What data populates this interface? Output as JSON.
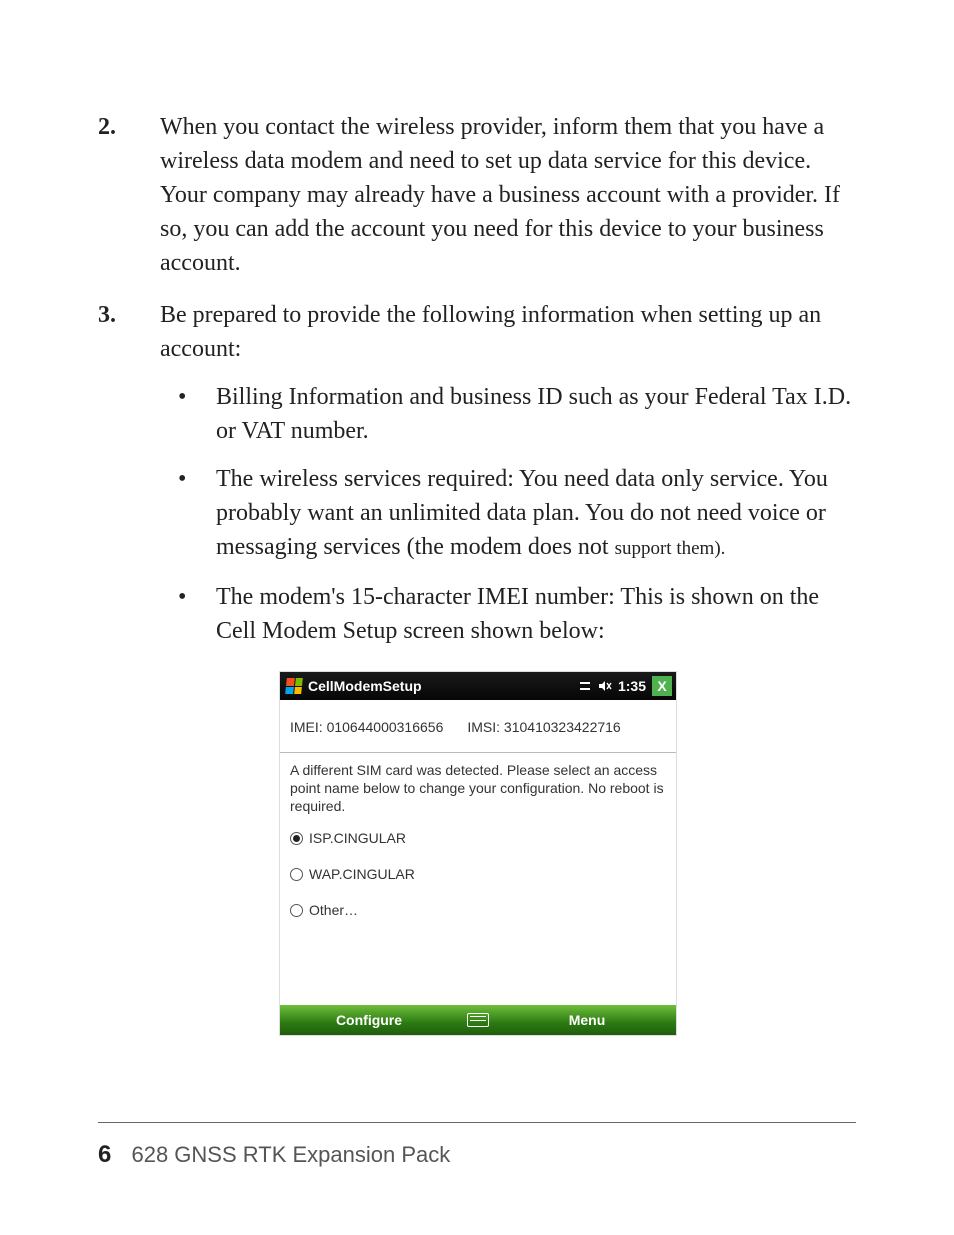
{
  "list": {
    "items": [
      {
        "num": "2.",
        "text": "When you contact the wireless provider, inform them that you have a wireless data modem and need to set up data service for this device. Your company may already have a business account with a provider. If so, you can add the account you need for this device to your business account."
      },
      {
        "num": "3.",
        "text": "Be prepared to provide the following information when setting up an account:",
        "bullets": [
          {
            "text": "Billing Information and business ID such as your Federal Tax I.D. or VAT number."
          },
          {
            "text_main": "The wireless services required: You need data only service. You probably want an unlimited data plan. You do not need voice or messaging services (the modem does not ",
            "text_small": "support them)."
          },
          {
            "text": "The modem's 15-character IMEI number: This is shown on the Cell Modem Setup screen shown below:"
          }
        ]
      }
    ]
  },
  "screenshot": {
    "title": "CellModemSetup",
    "clock": "1:35",
    "speaker_muted_label": "×",
    "close_label": "X",
    "imei_label": "IMEI: ",
    "imei_value": "010644000316656",
    "imsi_label": "IMSI: ",
    "imsi_value": "310410323422716",
    "detect_message": "A different SIM card was detected.  Please select an access point name below to change your configuration.  No reboot is required.",
    "radios": [
      {
        "label": "ISP.CINGULAR",
        "selected": true
      },
      {
        "label": "WAP.CINGULAR",
        "selected": false
      },
      {
        "label": "Other…",
        "selected": false
      }
    ],
    "soft_left": "Configure",
    "soft_right": "Menu"
  },
  "footer": {
    "page_number": "6",
    "title": "628 GNSS RTK Expansion Pack"
  }
}
